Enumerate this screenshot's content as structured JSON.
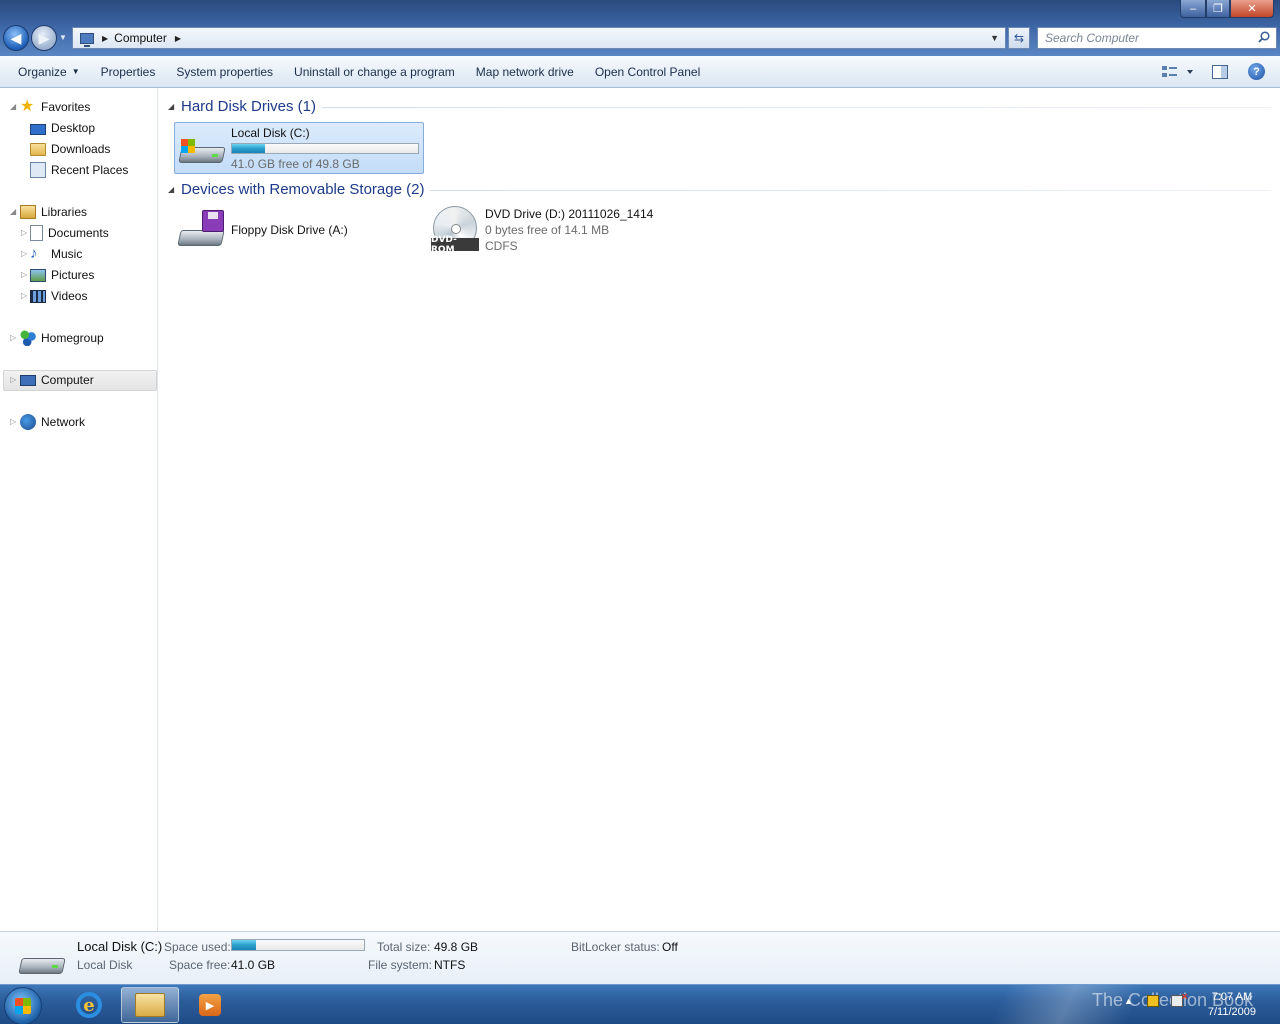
{
  "window": {
    "min_glyph": "‒",
    "max_glyph": "❐",
    "close_glyph": "✕"
  },
  "address": {
    "location": "Computer",
    "search_placeholder": "Search Computer"
  },
  "toolbar": {
    "organize": "Organize",
    "properties": "Properties",
    "system_properties": "System properties",
    "uninstall": "Uninstall or change a program",
    "map_drive": "Map network drive",
    "control_panel": "Open Control Panel"
  },
  "nav": {
    "favorites": "Favorites",
    "desktop": "Desktop",
    "downloads": "Downloads",
    "recent_places": "Recent Places",
    "libraries": "Libraries",
    "documents": "Documents",
    "music": "Music",
    "pictures": "Pictures",
    "videos": "Videos",
    "homegroup": "Homegroup",
    "computer": "Computer",
    "network": "Network"
  },
  "groups": {
    "hard_disks": "Hard Disk Drives (1)",
    "removable": "Devices with Removable Storage (2)"
  },
  "drives": {
    "c": {
      "name": "Local Disk (C:)",
      "free": "41.0 GB free of 49.8 GB",
      "used_fraction": 0.18
    },
    "a": {
      "name": "Floppy Disk Drive (A:)"
    },
    "d": {
      "name": "DVD Drive (D:) 20111026_1414",
      "free": "0 bytes free of 14.1 MB",
      "fs": "CDFS",
      "badge": "DVD-ROM"
    }
  },
  "details": {
    "name": "Local Disk (C:)",
    "type": "Local Disk",
    "space_used_label": "Space used:",
    "space_free_label": "Space free:",
    "space_free_value": "41.0 GB",
    "total_size_label": "Total size:",
    "total_size_value": "49.8 GB",
    "file_system_label": "File system:",
    "file_system_value": "NTFS",
    "bitlocker_label": "BitLocker status:",
    "bitlocker_value": "Off",
    "used_fraction": 0.18
  },
  "taskbar": {
    "watermark": "The Collection Book",
    "time": "7:07 AM",
    "date": "7/11/2009"
  },
  "colors": {
    "accent": "#1e3a8a",
    "bar_fill": "#2a9fcd"
  }
}
